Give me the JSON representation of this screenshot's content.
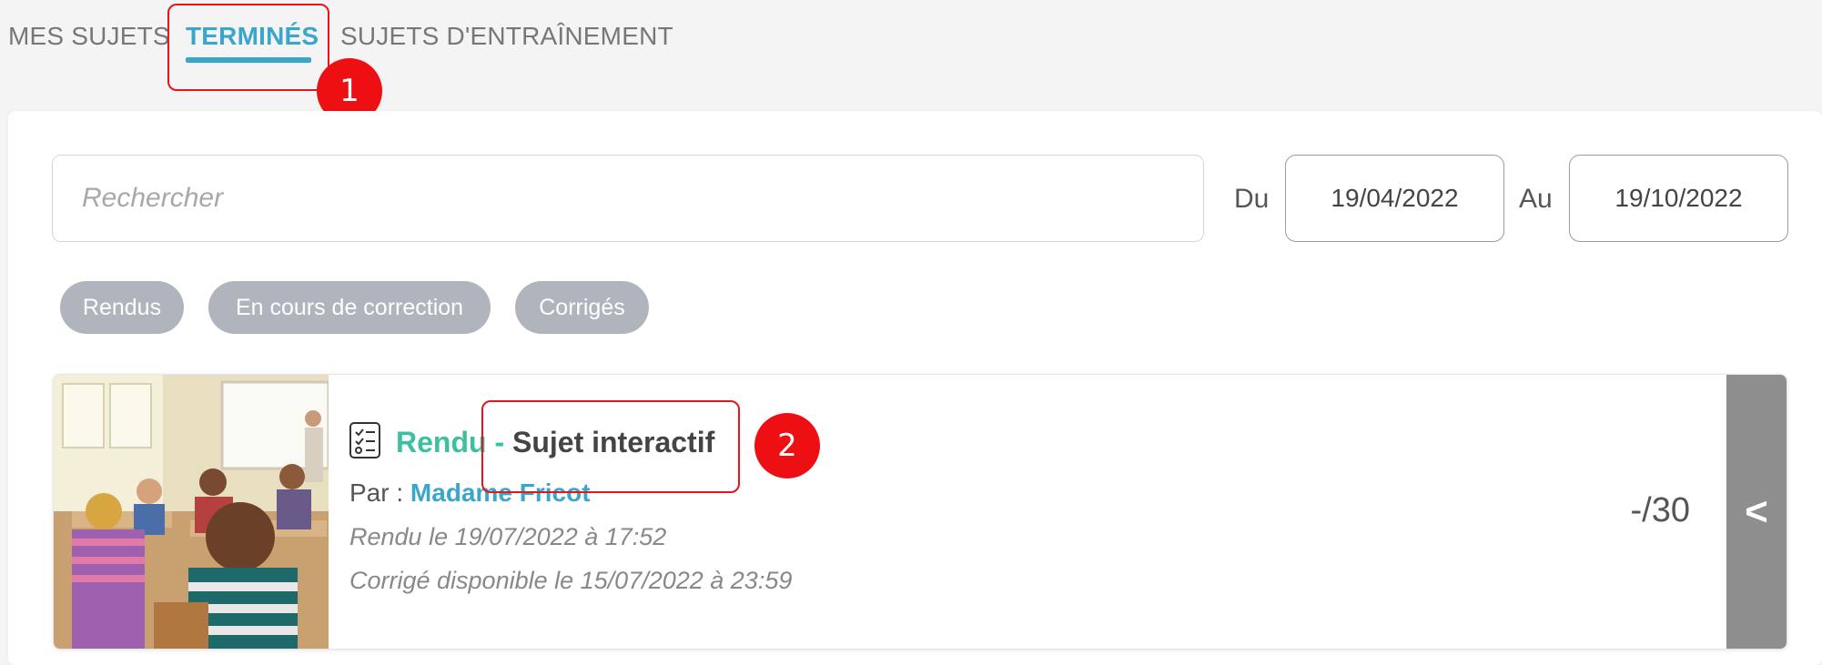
{
  "tabs": [
    {
      "label": "MES SUJETS"
    },
    {
      "label": "TERMINÉS",
      "active": true
    },
    {
      "label": "SUJETS D'ENTRAÎNEMENT"
    }
  ],
  "annotations": {
    "first": "1",
    "second": "2"
  },
  "search": {
    "placeholder": "Rechercher"
  },
  "date_filter": {
    "from_label": "Du",
    "from_value": "19/04/2022",
    "to_label": "Au",
    "to_value": "19/10/2022"
  },
  "status_filters": [
    "Rendus",
    "En cours de correction",
    "Corrigés"
  ],
  "submission": {
    "status": "Rendu",
    "separator": " - ",
    "subject": "Sujet interactif",
    "author_prefix": "Par : ",
    "author": "Madame Fricot",
    "submitted": "Rendu le 19/07/2022 à 17:52",
    "correction": "Corrigé disponible le 15/07/2022 à 23:59",
    "score": "-/30",
    "expand_icon": "<"
  },
  "colors": {
    "accent": "#3aa6cc",
    "status_green": "#3cc0a0",
    "annotation_red": "#ee0f12",
    "chip_gray": "#b0b5bd",
    "expand_gray": "#8e8e8e"
  }
}
